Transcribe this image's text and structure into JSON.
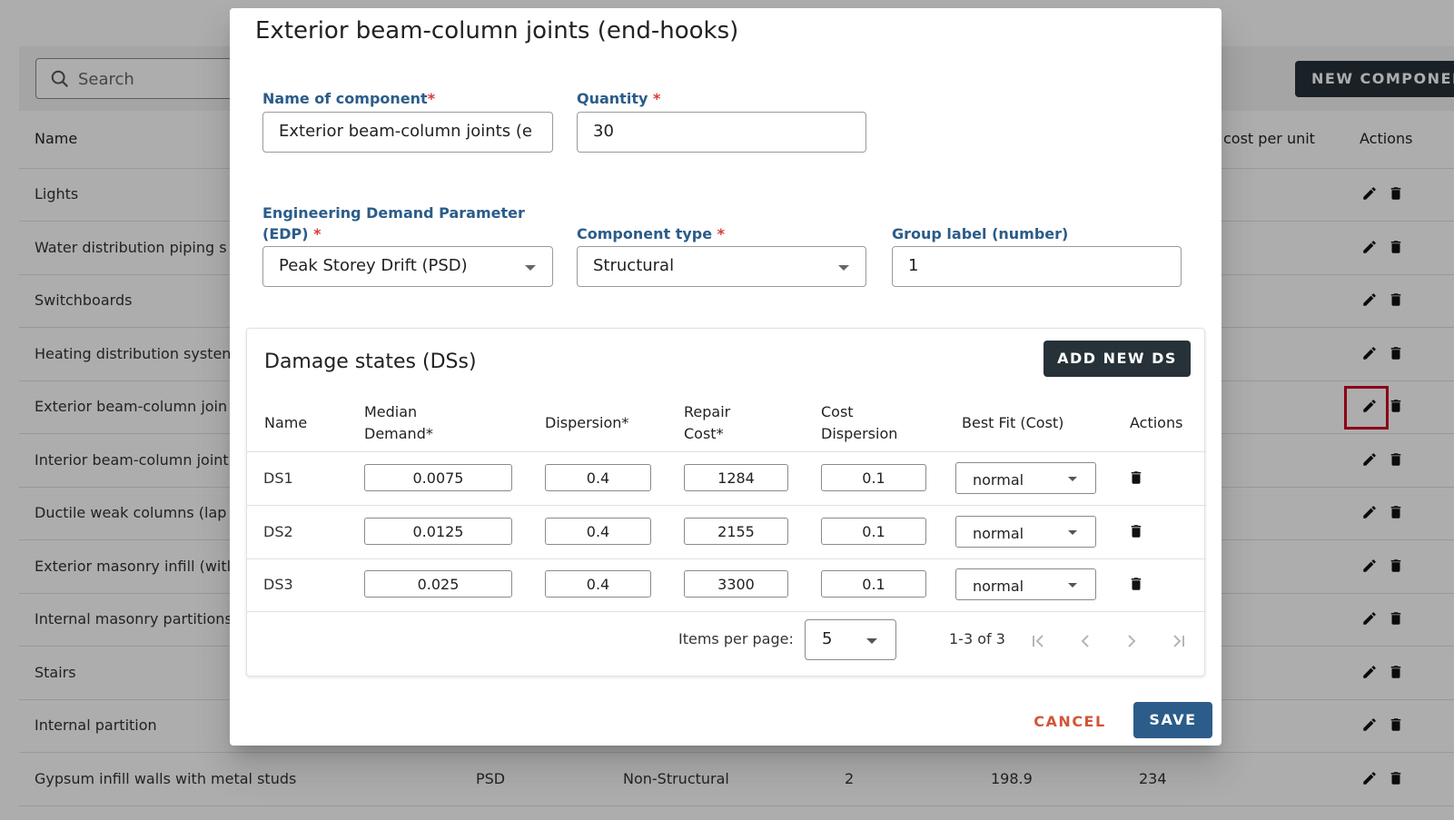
{
  "background": {
    "search": {
      "placeholder": "Search"
    },
    "new_component_button": "NEW COMPONENT",
    "table_headers": {
      "name": "Name",
      "cost_per_unit": "cost per unit",
      "actions": "Actions"
    },
    "rows": [
      {
        "name": "Lights"
      },
      {
        "name": "Water distribution piping s"
      },
      {
        "name": "Switchboards"
      },
      {
        "name": "Heating distribution systen"
      },
      {
        "name": "Exterior beam-column join"
      },
      {
        "name": "Interior beam-column joint"
      },
      {
        "name": "Ductile weak columns (lap"
      },
      {
        "name": "Exterior masonry infill (witl"
      },
      {
        "name": "Internal masonry partitions"
      },
      {
        "name": "Stairs"
      },
      {
        "name": "Internal partition"
      },
      {
        "name": "Gypsum infill walls with metal studs",
        "edp": "PSD",
        "type": "Non-Structural",
        "group": "2",
        "val1": "198.9",
        "val2": "234"
      }
    ]
  },
  "dialog": {
    "title": "Exterior beam-column joints (end-hooks)",
    "name_label": "Name of component",
    "name_value": "Exterior beam-column joints (e",
    "quantity_label": "Quantity ",
    "quantity_value": "30",
    "edp_label_line1": "Engineering Demand Parameter",
    "edp_label_line2": "(EDP) ",
    "edp_value": "Peak Storey Drift (PSD)",
    "type_label": "Component type ",
    "type_value": "Structural",
    "group_label": "Group label (number)",
    "group_value": "1",
    "required_mark": "*",
    "ds": {
      "title": "Damage states (DSs)",
      "add_button": "ADD NEW DS",
      "headers": {
        "name": "Name",
        "median_1": "Median",
        "median_2": "Demand*",
        "dispersion": "Dispersion*",
        "repair_1": "Repair",
        "repair_2": "Cost*",
        "costdisp_1": "Cost",
        "costdisp_2": "Dispersion",
        "bestfit": "Best Fit (Cost)",
        "actions": "Actions"
      },
      "rows": [
        {
          "name": "DS1",
          "median": "0.0075",
          "dispersion": "0.4",
          "repair_cost": "1284",
          "cost_dispersion": "0.1",
          "best_fit": "normal"
        },
        {
          "name": "DS2",
          "median": "0.0125",
          "dispersion": "0.4",
          "repair_cost": "2155",
          "cost_dispersion": "0.1",
          "best_fit": "normal"
        },
        {
          "name": "DS3",
          "median": "0.025",
          "dispersion": "0.4",
          "repair_cost": "3300",
          "cost_dispersion": "0.1",
          "best_fit": "normal"
        }
      ],
      "paginator": {
        "items_per_page_label": "Items per page:",
        "page_size": "5",
        "range": "1-3 of 3"
      }
    },
    "cancel_button": "CANCEL",
    "save_button": "SAVE"
  },
  "colors": {
    "primary": "#2b5c8a",
    "dark_button": "#263238",
    "cancel": "#d2553a",
    "required": "#d83a3a",
    "highlight": "#8b0016"
  },
  "icons": [
    "search-icon",
    "edit-icon",
    "delete-icon",
    "chevron-down-icon",
    "first-page-icon",
    "prev-page-icon",
    "next-page-icon",
    "last-page-icon"
  ]
}
